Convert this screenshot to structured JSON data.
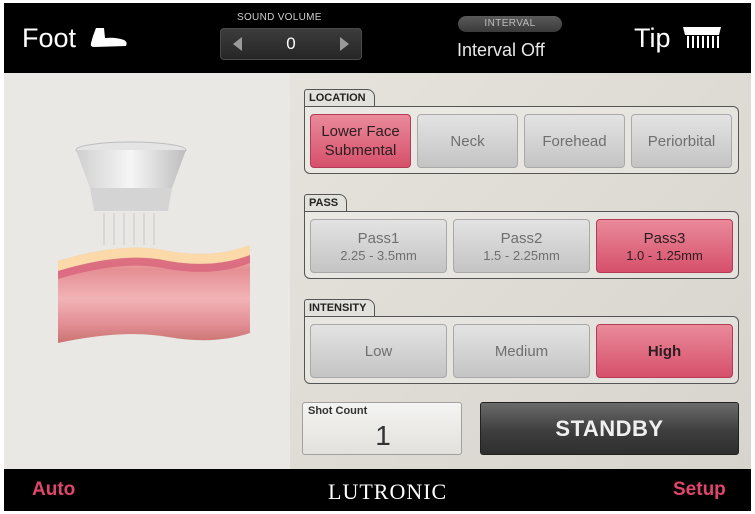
{
  "topbar": {
    "foot_label": "Foot",
    "foot_icon": "foot-icon",
    "sound_volume_title": "SOUND VOLUME",
    "sound_volume_value": "0",
    "interval_title": "INTERVAL",
    "interval_value": "Interval Off",
    "tip_label": "Tip",
    "tip_icon": "tip-icon"
  },
  "location": {
    "title": "LOCATION",
    "options": [
      {
        "line1": "Lower Face",
        "line2": "Submental",
        "selected": true
      },
      {
        "line1": "Neck",
        "selected": false
      },
      {
        "line1": "Forehead",
        "selected": false
      },
      {
        "line1": "Periorbital",
        "selected": false
      }
    ]
  },
  "pass": {
    "title": "PASS",
    "options": [
      {
        "line1": "Pass1",
        "line2": "2.25 - 3.5mm",
        "selected": false
      },
      {
        "line1": "Pass2",
        "line2": "1.5 - 2.25mm",
        "selected": false
      },
      {
        "line1": "Pass3",
        "line2": "1.0 - 1.25mm",
        "selected": true
      }
    ]
  },
  "intensity": {
    "title": "INTENSITY",
    "options": [
      {
        "line1": "Low",
        "selected": false
      },
      {
        "line1": "Medium",
        "selected": false
      },
      {
        "line1": "High",
        "selected": true
      }
    ]
  },
  "shot_count": {
    "label": "Shot Count",
    "value": "1"
  },
  "standby_label": "STANDBY",
  "bottombar": {
    "auto_label": "Auto",
    "logo_text": "LUTRONIC",
    "setup_label": "Setup"
  },
  "colors": {
    "accent": "#e0466b",
    "selected_button": "#d6506b",
    "top_bar": "#000000"
  }
}
